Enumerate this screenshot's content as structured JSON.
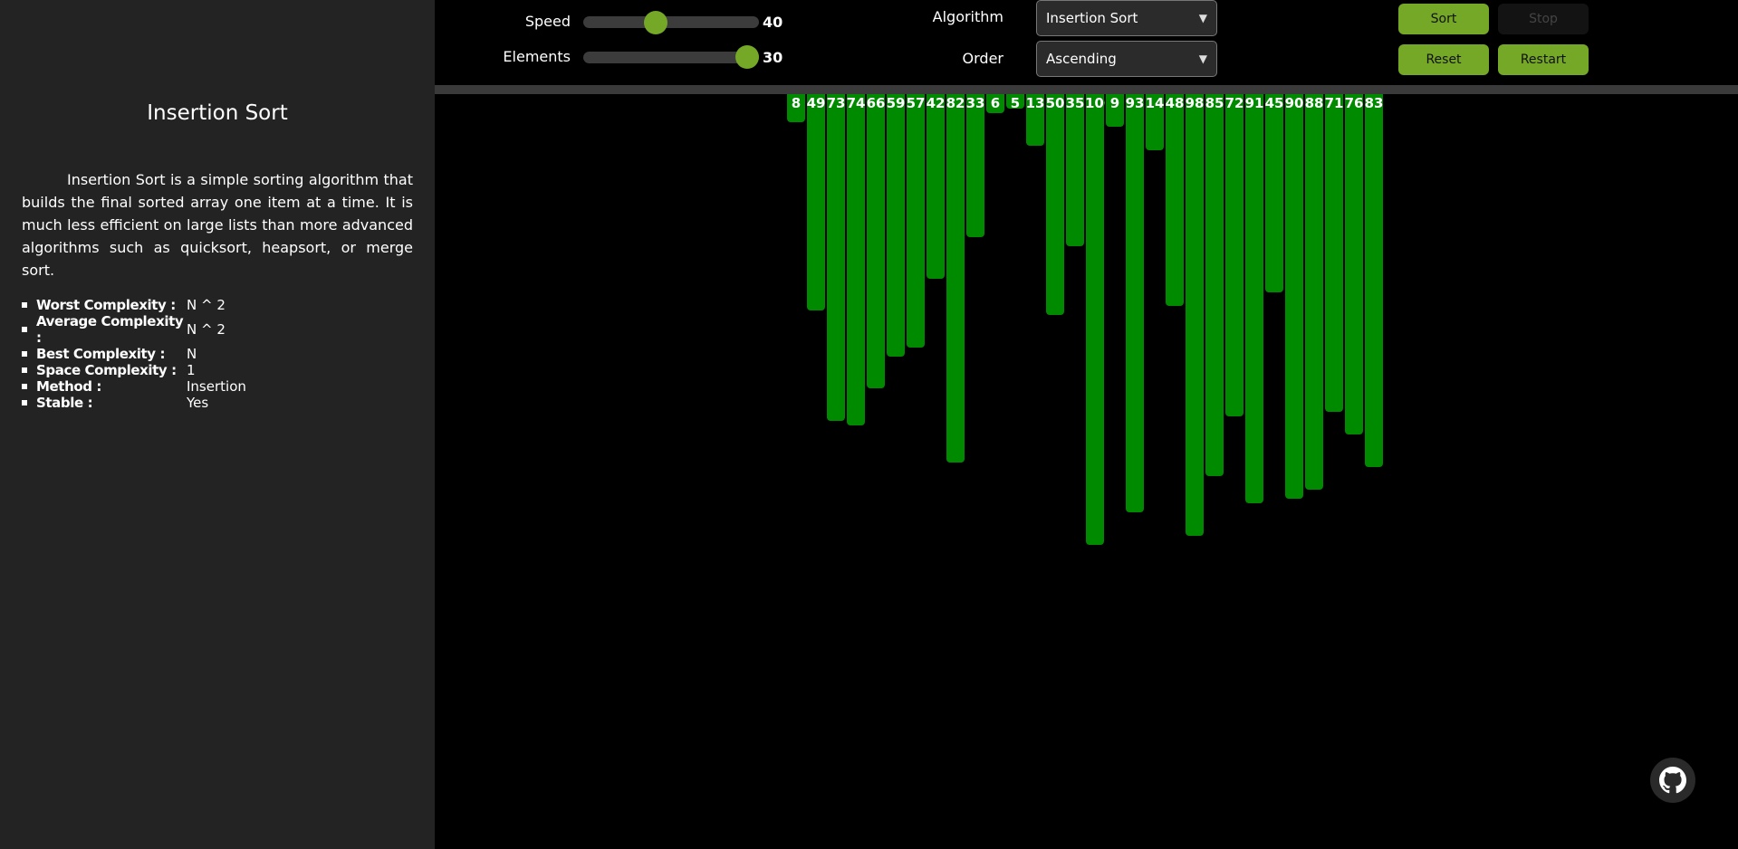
{
  "sidebar": {
    "title": "Insertion Sort",
    "description": "Insertion Sort is a simple sorting algorithm that builds the final sorted array one item at a time. It is much less efficient on large lists than more advanced algorithms such as quicksort, heapsort, or merge sort.",
    "properties": [
      {
        "key": "Worst Complexity :",
        "value": "N ^ 2"
      },
      {
        "key": "Average Complexity :",
        "value": "N ^ 2"
      },
      {
        "key": "Best Complexity :",
        "value": "N"
      },
      {
        "key": "Space Complexity :",
        "value": "1"
      },
      {
        "key": "Method :",
        "value": "Insertion"
      },
      {
        "key": "Stable :",
        "value": "Yes"
      }
    ]
  },
  "controls": {
    "speed_label": "Speed",
    "speed_value": "40",
    "speed_fraction": 0.4,
    "elements_label": "Elements",
    "elements_value": "30",
    "elements_fraction": 1.0,
    "algorithm_label": "Algorithm",
    "algorithm_value": "Insertion Sort",
    "order_label": "Order",
    "order_value": "Ascending",
    "sort_label": "Sort",
    "stop_label": "Stop",
    "reset_label": "Reset",
    "restart_label": "Restart"
  },
  "bars": {
    "color": "#008a00",
    "values": [
      8,
      49,
      73,
      74,
      66,
      59,
      57,
      42,
      82,
      33,
      6,
      5,
      13,
      50,
      35,
      100,
      9,
      93,
      14,
      48,
      98,
      85,
      72,
      91,
      45,
      90,
      88,
      71,
      76,
      83
    ]
  },
  "icons": {
    "github": "github-icon"
  },
  "colors": {
    "accent": "#74a826",
    "bar": "#008a00",
    "sidebar_bg": "#232323"
  }
}
